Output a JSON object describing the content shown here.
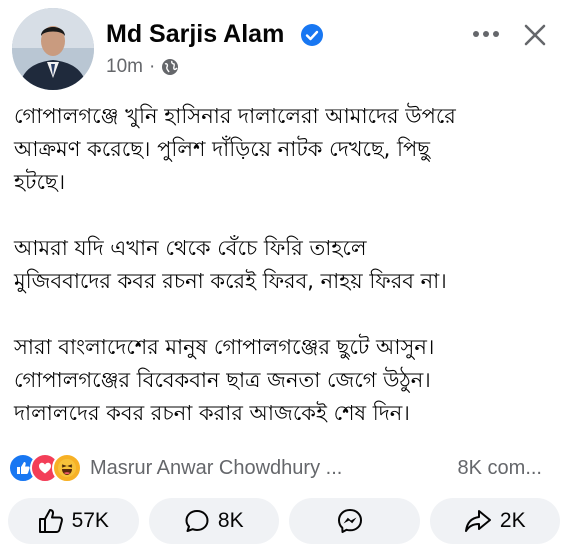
{
  "header": {
    "author": "Md Sarjis Alam",
    "time": "10m",
    "separator": "·",
    "verified_color": "#1877f2"
  },
  "post": {
    "paragraphs": [
      "গোপালগঞ্জে খুনি হাসিনার দালালেরা আমাদের উপরে\nআক্রমণ করেছে। পুলিশ দাঁড়িয়ে নাটক দেখছে, পিছু\nহটছে।",
      "আমরা যদি এখান থেকে বেঁচে ফিরি তাহলে\nমুজিববাদের কবর রচনা করেই ফিরব, নাহয় ফিরব না।",
      "সারা বাংলাদেশের মানুষ গোপালগঞ্জের ছুটে আসুন।\nগোপালগঞ্জের বিবেকবান ছাত্র জনতা জেগে উঠুন।\nদালালদের কবর রচনা করার আজকেই শেষ দিন।"
    ]
  },
  "reactions": {
    "icons": [
      "like-icon",
      "love-icon",
      "haha-icon"
    ],
    "names": "Masrur Anwar Chowdhury ...",
    "comments": "8K com..."
  },
  "actions": {
    "like": "57K",
    "comment": "8K",
    "messenger": "",
    "share": "2K"
  }
}
